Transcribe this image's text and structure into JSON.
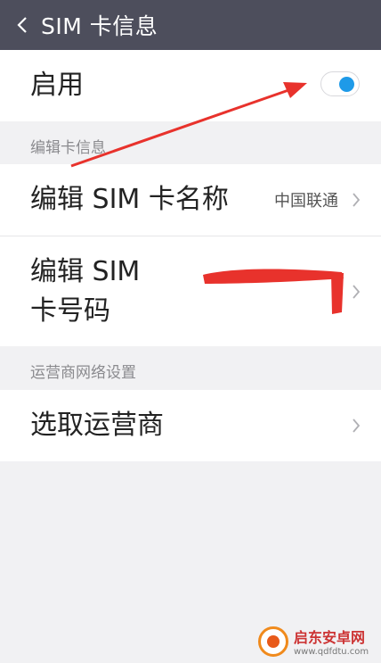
{
  "header": {
    "title": "SIM  卡信息"
  },
  "enable_row": {
    "label": "启用",
    "toggle_on": true
  },
  "sections": {
    "card_info_header": "编辑卡信息",
    "network_header": "运营商网络设置"
  },
  "card_rows": {
    "name_label": "编辑 SIM 卡名称",
    "name_value": "中国联通",
    "number_label_line1": "编辑 SIM",
    "number_label_line2": "卡号码"
  },
  "network_rows": {
    "carrier_label": "选取运营商"
  },
  "watermark": {
    "title": "启东安卓网",
    "url": "www.qdfdtu.com"
  },
  "colors": {
    "titlebar": "#4d4e5c",
    "toggle_knob": "#1e9ae8",
    "annotation": "#e8322c"
  }
}
